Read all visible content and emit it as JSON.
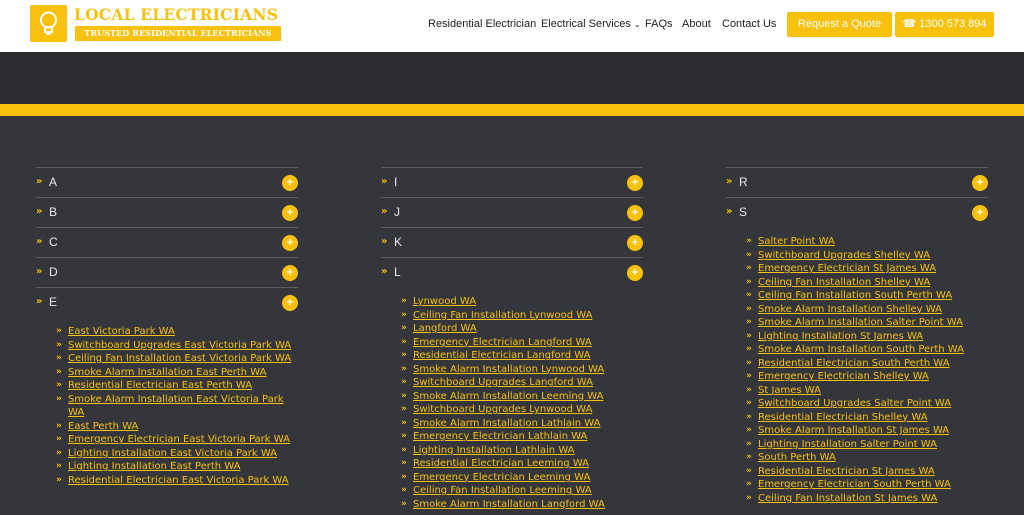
{
  "header": {
    "logo_title": "LOCAL ELECTRICIANS",
    "logo_subtitle": "TRUSTED RESIDENTIAL ELECTRICIANS",
    "nav": [
      "Residential Electrician",
      "Electrical Services",
      "FAQs",
      "About",
      "Contact Us"
    ],
    "quote_button": "Request a Quote",
    "phone_button": "1300 573 894",
    "accent_color": "#f7c10d"
  },
  "columns": [
    {
      "letters": [
        "A",
        "B",
        "C",
        "D",
        "E"
      ],
      "links": [
        "East Victoria Park WA",
        "Switchboard Upgrades East Victoria Park WA",
        "Ceiling Fan Installation East Victoria Park WA",
        "Smoke Alarm Installation East Perth WA",
        "Residential Electrician East Perth WA",
        "Smoke Alarm Installation East Victoria Park WA",
        "East Perth WA",
        "Emergency Electrician East Victoria Park WA",
        "Lighting Installation East Victoria Park WA",
        "Lighting Installation East Perth WA",
        "Residential Electrician East Victoria Park WA"
      ]
    },
    {
      "letters": [
        "I",
        "J",
        "K",
        "L"
      ],
      "links": [
        "Lynwood WA",
        "Ceiling Fan Installation Lynwood WA",
        "Langford WA",
        "Emergency Electrician Langford WA",
        "Residential Electrician Langford WA",
        "Smoke Alarm Installation Lynwood WA",
        "Switchboard Upgrades Langford WA",
        "Smoke Alarm Installation Leeming WA",
        "Switchboard Upgrades Lynwood WA",
        "Smoke Alarm Installation Lathlain WA",
        "Emergency Electrician Lathlain WA",
        "Lighting Installation Lathlain WA",
        "Residential Electrician Leeming WA",
        "Emergency Electrician Leeming WA",
        "Ceiling Fan Installation Leeming WA",
        "Smoke Alarm Installation Langford WA"
      ]
    },
    {
      "letters": [
        "R",
        "S"
      ],
      "links": [
        "Salter Point WA",
        "Switchboard Upgrades Shelley WA",
        "Emergency Electrician St James WA",
        "Ceiling Fan Installation Shelley WA",
        "Ceiling Fan Installation South Perth WA",
        "Smoke Alarm Installation Shelley WA",
        "Smoke Alarm Installation Salter Point WA",
        "Lighting Installation St James WA",
        "Smoke Alarm Installation South Perth WA",
        "Residential Electrician South Perth WA",
        "Emergency Electrician Shelley WA",
        "St James WA",
        "Switchboard Upgrades Salter Point WA",
        "Residential Electrician Shelley WA",
        "Smoke Alarm Installation St James WA",
        "Lighting Installation Salter Point WA",
        "South Perth WA",
        "Residential Electrician St James WA",
        "Emergency Electrician South Perth WA",
        "Ceiling Fan Installation St James WA"
      ]
    }
  ]
}
